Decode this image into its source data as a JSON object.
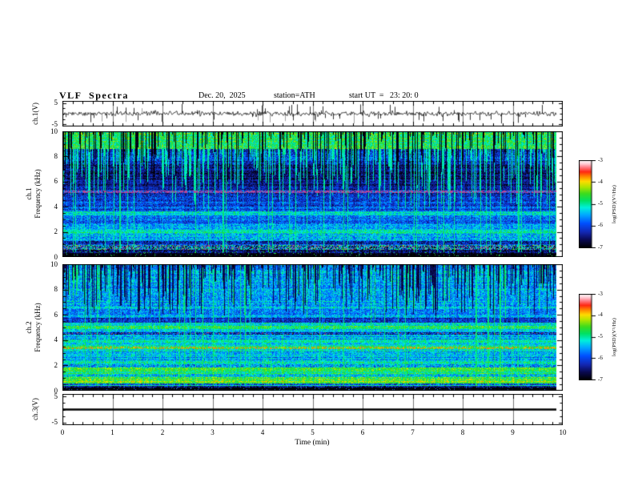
{
  "header": {
    "title": "VLF  Spectra",
    "date": "Dec. 20,  2025",
    "station": "station=ATH",
    "start_ut": "start UT  =   23: 20: 0"
  },
  "xaxis": {
    "label": "Time  (min)",
    "tick_labels": [
      "0",
      "1",
      "2",
      "3",
      "4",
      "5",
      "6",
      "7",
      "8",
      "9",
      "10"
    ],
    "range_min": [
      0,
      10
    ],
    "minor_tick_step_min": 0.2
  },
  "colorbar": {
    "label": "log(PSD)(V²/Hz)",
    "tick_labels": [
      "-3",
      "-4",
      "-5",
      "-6",
      "-7"
    ],
    "tick_values": [
      -3,
      -4,
      -5,
      -6,
      -7
    ],
    "range": [
      -7,
      -3
    ],
    "colormap_stops": [
      [
        0.0,
        "#000000"
      ],
      [
        0.09,
        "#0a0a50"
      ],
      [
        0.18,
        "#1428b4"
      ],
      [
        0.28,
        "#0050ff"
      ],
      [
        0.38,
        "#00aaff"
      ],
      [
        0.46,
        "#00f0dc"
      ],
      [
        0.54,
        "#00e164"
      ],
      [
        0.62,
        "#3cdc1e"
      ],
      [
        0.7,
        "#b4e600"
      ],
      [
        0.76,
        "#ffdc00"
      ],
      [
        0.82,
        "#ff8200"
      ],
      [
        0.87,
        "#ff2814"
      ],
      [
        0.92,
        "#ff7882"
      ],
      [
        0.96,
        "#ffc8d2"
      ],
      [
        1.0,
        "#ffffff"
      ]
    ]
  },
  "colors": {
    "background": "#ffffff",
    "frame": "#000000",
    "trace": "#000000",
    "gridline": "#777777",
    "gray_spike": "#a0a0a0"
  },
  "chart_data": [
    {
      "type": "line",
      "name": "ch.1 waveform",
      "ylabel": "ch.1(V)",
      "yticks": [
        5,
        -5
      ],
      "ytick_labels": [
        "5",
        "-5"
      ],
      "ylim": [
        -6,
        6
      ],
      "x_range_min": [
        0,
        10
      ],
      "data_end_min": 9.87,
      "description": "broadband noise of about ±1 V with many impulsive sferic spikes reaching ±5 V",
      "noise_amp_v": 0.85,
      "spike_count": 46,
      "spike_amp_v": [
        1.5,
        4.6
      ],
      "gray_spike_count": 8,
      "seed": 11
    },
    {
      "type": "heatmap",
      "name": "ch.1 spectrogram",
      "ylabel_line1": "ch.1",
      "ylabel_line2": "Frequency  (kHz)",
      "ylim": [
        0,
        10
      ],
      "yticks": [
        10,
        8,
        6,
        4,
        2,
        0
      ],
      "ytick_labels": [
        "10",
        "8",
        "6",
        "4",
        "2",
        "0"
      ],
      "zlabel": "log(PSD)(V²/Hz)",
      "zlim": [
        -7,
        -3
      ],
      "data_end_min": 9.87,
      "psd_bands": [
        [
          0.0,
          0.3,
          -7.0,
          0.15
        ],
        [
          0.3,
          0.6,
          -6.6,
          0.5
        ],
        [
          0.6,
          0.95,
          -5.8,
          1.3
        ],
        [
          0.95,
          1.25,
          -6.1,
          0.6
        ],
        [
          1.25,
          1.9,
          -5.4,
          0.55
        ],
        [
          1.9,
          2.15,
          -5.05,
          0.4
        ],
        [
          2.15,
          2.6,
          -5.65,
          0.5
        ],
        [
          2.6,
          3.3,
          -5.85,
          0.5
        ],
        [
          3.3,
          3.65,
          -5.3,
          0.45
        ],
        [
          3.65,
          4.4,
          -5.95,
          0.5
        ],
        [
          4.4,
          5.1,
          -6.2,
          0.5
        ],
        [
          5.1,
          5.3,
          -6.0,
          0.6
        ],
        [
          5.3,
          7.3,
          -6.5,
          0.4
        ],
        [
          7.3,
          8.6,
          -6.1,
          0.55
        ],
        [
          8.6,
          10.0,
          -4.75,
          0.5
        ]
      ],
      "overrides": [
        {
          "f_lo": 5.1,
          "f_hi": 5.3,
          "prob": 0.55,
          "rgb": [
            185,
            70,
            150
          ]
        },
        {
          "f_lo": 0.6,
          "f_hi": 0.95,
          "prob": 0.1,
          "rgb": [
            175,
            75,
            160
          ]
        },
        {
          "f_lo": 0.6,
          "f_hi": 0.95,
          "prob": 0.08,
          "rgb": [
            150,
            150,
            135
          ]
        },
        {
          "f_lo": 0.0,
          "f_hi": 0.45,
          "prob": 0.05,
          "rgb": [
            40,
            220,
            70
          ]
        }
      ],
      "streaks": {
        "bright_p": 0.5,
        "bright_from": 8.6,
        "bright_depth": 5.0,
        "bright_v": -5.05,
        "dark_p": 0.32,
        "dark_from": 10,
        "dark_depth": 4.2,
        "dark_v": -6.75,
        "full_p": 0.05,
        "full_v": -4.95,
        "full_fmin": 0.4
      },
      "seed": 7
    },
    {
      "type": "heatmap",
      "name": "ch.2 spectrogram",
      "ylabel_line1": "ch.2",
      "ylabel_line2": "Frequency  (kHz)",
      "ylim": [
        0,
        10
      ],
      "yticks": [
        10,
        8,
        6,
        4,
        2,
        0
      ],
      "ytick_labels": [
        "10",
        "8",
        "6",
        "4",
        "2",
        "0"
      ],
      "zlabel": "log(PSD)(V²/Hz)",
      "zlim": [
        -7,
        -3
      ],
      "data_end_min": 9.87,
      "psd_bands": [
        [
          0.0,
          0.25,
          -7.0,
          0.12
        ],
        [
          0.25,
          0.35,
          -6.5,
          0.5
        ],
        [
          0.35,
          0.45,
          -4.9,
          0.5
        ],
        [
          0.45,
          0.6,
          -6.1,
          0.6
        ],
        [
          0.6,
          0.75,
          -4.45,
          0.4
        ],
        [
          0.75,
          1.05,
          -4.65,
          0.5
        ],
        [
          1.05,
          1.3,
          -5.3,
          0.65
        ],
        [
          1.3,
          1.85,
          -4.8,
          0.45
        ],
        [
          1.85,
          2.1,
          -5.4,
          0.7
        ],
        [
          2.1,
          2.4,
          -5.0,
          0.45
        ],
        [
          2.4,
          3.1,
          -5.5,
          0.5
        ],
        [
          3.1,
          3.28,
          -5.0,
          0.45
        ],
        [
          3.28,
          3.55,
          -4.85,
          0.55
        ],
        [
          3.55,
          3.8,
          -5.25,
          0.45
        ],
        [
          3.8,
          4.05,
          -4.95,
          0.4
        ],
        [
          4.05,
          4.4,
          -5.55,
          0.5
        ],
        [
          4.4,
          4.62,
          -6.1,
          0.7
        ],
        [
          4.62,
          4.9,
          -5.3,
          0.45
        ],
        [
          4.9,
          5.1,
          -4.75,
          0.45
        ],
        [
          5.1,
          5.4,
          -5.3,
          0.5
        ],
        [
          5.4,
          5.75,
          -6.25,
          0.5
        ],
        [
          5.75,
          6.5,
          -5.6,
          0.5
        ],
        [
          6.5,
          10.0,
          -5.45,
          0.5
        ]
      ],
      "overrides": [
        {
          "f_lo": 3.28,
          "f_hi": 3.5,
          "prob": 0.28,
          "rgb": [
            255,
            120,
            20
          ]
        },
        {
          "f_lo": 4.4,
          "f_hi": 4.62,
          "prob": 0.07,
          "rgb": [
            200,
            60,
            40
          ]
        },
        {
          "f_lo": 0.0,
          "f_hi": 0.3,
          "prob": 0.05,
          "rgb": [
            60,
            120,
            255
          ]
        }
      ],
      "streaks": {
        "bright_p": 0.1,
        "bright_from": 10,
        "bright_depth": 4.5,
        "bright_v": -4.85,
        "dark_p": 0.42,
        "dark_from": 10,
        "dark_depth": 3.8,
        "dark_v": -6.5,
        "full_p": 0.04,
        "full_v": -4.9,
        "full_fmin": 0.35
      },
      "seed": 13
    },
    {
      "type": "line",
      "name": "ch.3 waveform",
      "ylabel": "ch.3(V)",
      "yticks": [
        5,
        -5
      ],
      "ytick_labels": [
        "5",
        "-5"
      ],
      "ylim": [
        -6,
        6
      ],
      "x_range_min": [
        0,
        10
      ],
      "data_end_min": 9.87,
      "description": "flat line at 0 V (no signal)",
      "flat_value_v": 0
    }
  ]
}
